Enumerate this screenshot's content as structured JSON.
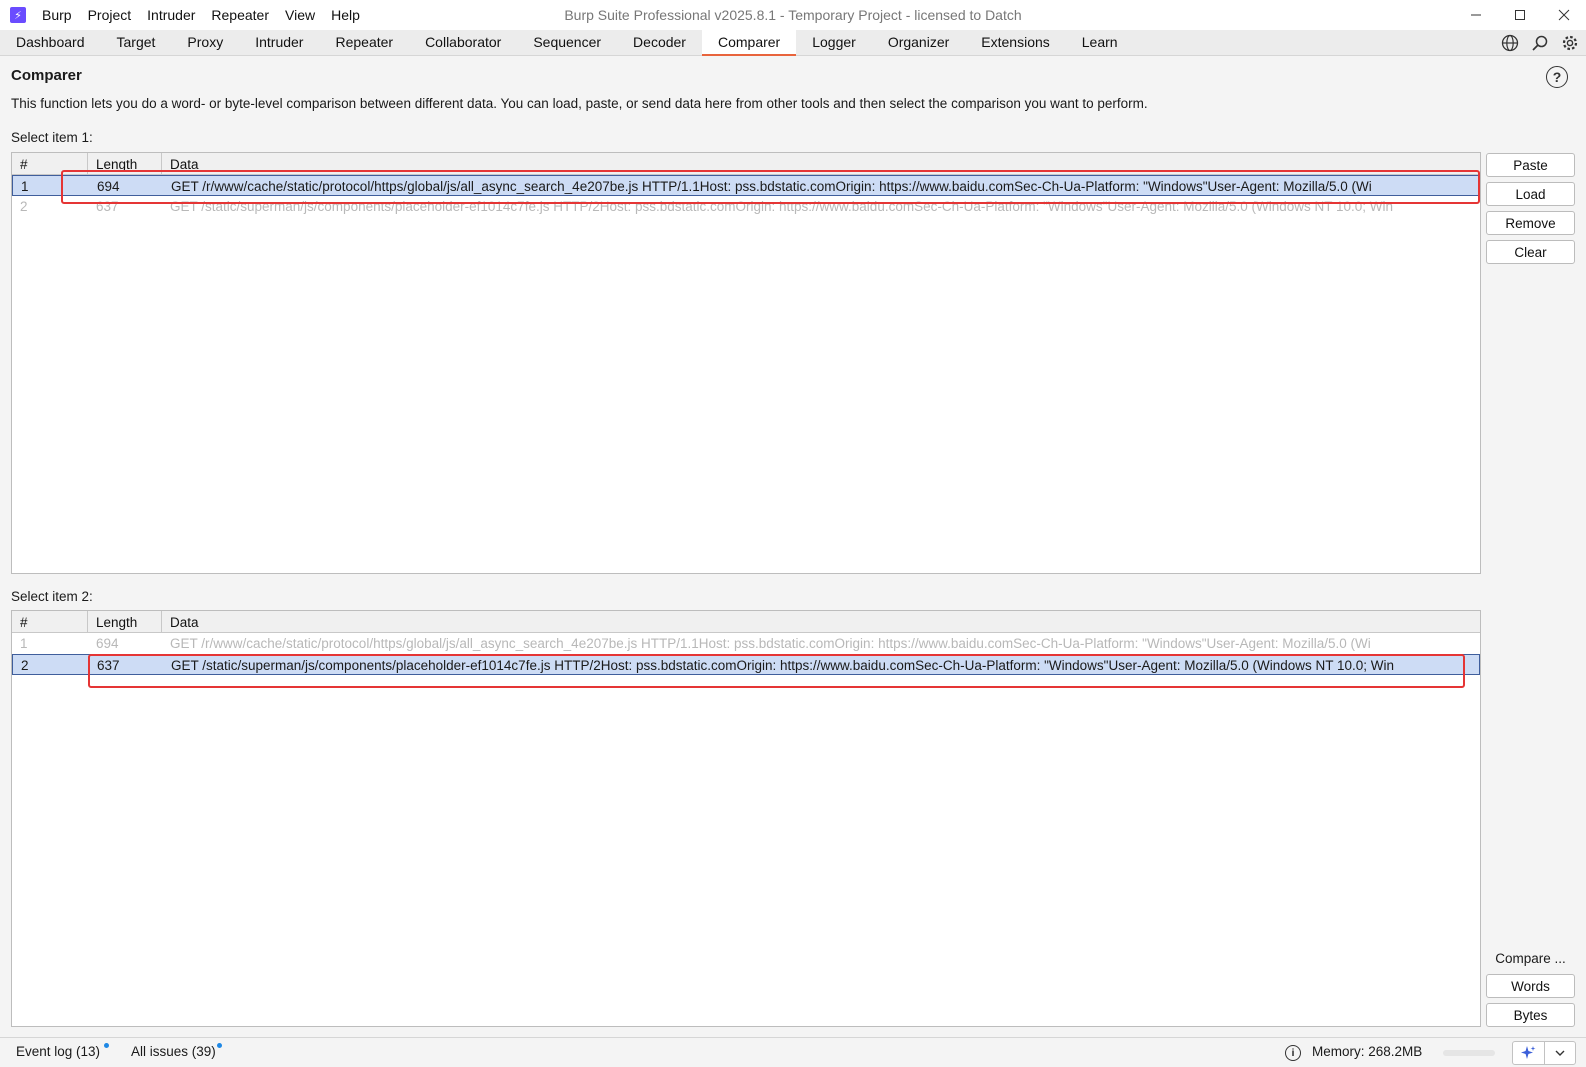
{
  "titlebar": {
    "logo_glyph": "⚡",
    "window_title": "Burp Suite Professional v2025.8.1 - Temporary Project - licensed to Datch",
    "menu": [
      "Burp",
      "Project",
      "Intruder",
      "Repeater",
      "View",
      "Help"
    ]
  },
  "tabs": [
    "Dashboard",
    "Target",
    "Proxy",
    "Intruder",
    "Repeater",
    "Collaborator",
    "Sequencer",
    "Decoder",
    "Comparer",
    "Logger",
    "Organizer",
    "Extensions",
    "Learn"
  ],
  "active_tab": "Comparer",
  "tab_icons": [
    "globe-icon",
    "search-icon",
    "gear-icon"
  ],
  "page": {
    "title": "Comparer",
    "help": "?",
    "description": "This function lets you do a word- or byte-level comparison between different data. You can load, paste, or send data here from other tools and then select the comparison you want to perform."
  },
  "columns": {
    "num": "#",
    "length": "Length",
    "data": "Data"
  },
  "item1": {
    "label": "Select item 1:",
    "rows": [
      {
        "num": "1",
        "length": "694",
        "data": "GET /r/www/cache/static/protocol/https/global/js/all_async_search_4e207be.js HTTP/1.1Host: pss.bdstatic.comOrigin: https://www.baidu.comSec-Ch-Ua-Platform: \"Windows\"User-Agent: Mozilla/5.0 (Wi",
        "selected": true
      },
      {
        "num": "2",
        "length": "637",
        "data": "GET /static/superman/js/components/placeholder-ef1014c7fe.js HTTP/2Host: pss.bdstatic.comOrigin: https://www.baidu.comSec-Ch-Ua-Platform: \"Windows\"User-Agent: Mozilla/5.0 (Windows NT 10.0; Win",
        "selected": false
      }
    ]
  },
  "item2": {
    "label": "Select item 2:",
    "rows": [
      {
        "num": "1",
        "length": "694",
        "data": "GET /r/www/cache/static/protocol/https/global/js/all_async_search_4e207be.js HTTP/1.1Host: pss.bdstatic.comOrigin: https://www.baidu.comSec-Ch-Ua-Platform: \"Windows\"User-Agent: Mozilla/5.0 (Wi",
        "selected": false
      },
      {
        "num": "2",
        "length": "637",
        "data": "GET /static/superman/js/components/placeholder-ef1014c7fe.js HTTP/2Host: pss.bdstatic.comOrigin: https://www.baidu.comSec-Ch-Ua-Platform: \"Windows\"User-Agent: Mozilla/5.0 (Windows NT 10.0; Win",
        "selected": true
      }
    ]
  },
  "buttons": {
    "paste": "Paste",
    "load": "Load",
    "remove": "Remove",
    "clear": "Clear",
    "compare_label": "Compare ...",
    "words": "Words",
    "bytes": "Bytes"
  },
  "statusbar": {
    "event_log": "Event log (13)",
    "all_issues": "All issues (39)",
    "memory": "Memory: 268.2MB"
  },
  "colors": {
    "accent_tab": "#e8643c",
    "selection": "#cddcf5",
    "annotation_red": "#e53535",
    "notify_dot": "#1e88e5"
  }
}
